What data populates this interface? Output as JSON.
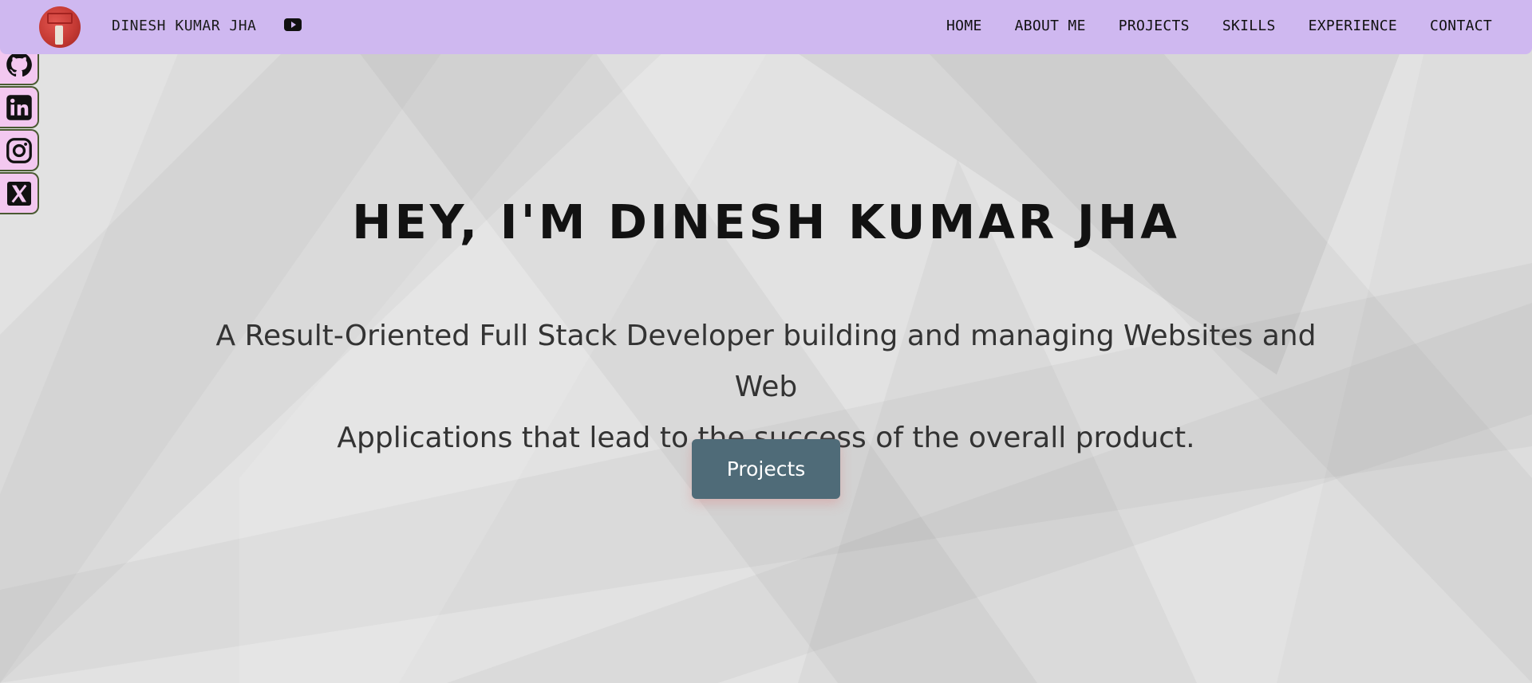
{
  "header": {
    "brand_name": "DINESH KUMAR JHA",
    "nav": [
      "HOME",
      "ABOUT ME",
      "PROJECTS",
      "SKILLS",
      "EXPERIENCE",
      "CONTACT"
    ]
  },
  "social": [
    "github-icon",
    "linkedin-icon",
    "instagram-icon",
    "x-icon"
  ],
  "hero": {
    "title": "HEY, I'M DINESH KUMAR JHA",
    "subtitle_line1": "A Result-Oriented Full Stack Developer building and managing Websites and Web",
    "subtitle_line2": "Applications that lead to the success of the overall product.",
    "button_label": "Projects"
  },
  "colors": {
    "header_bg": "#cfb8f0",
    "social_bg": "#f3c8f0",
    "button_bg": "#4f6b78",
    "page_bg": "#e2e2e2"
  }
}
